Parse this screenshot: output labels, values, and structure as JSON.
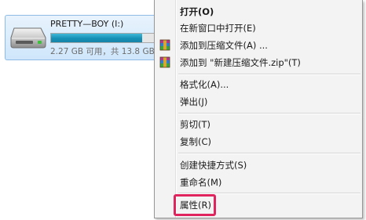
{
  "drive": {
    "name": "PRETTY—BOY (I:)",
    "space_text": "2.27 GB 可用，共 13.8 GB",
    "used_fraction": 0.84,
    "icon": "usb-drive-icon"
  },
  "context_menu": {
    "items": [
      {
        "label": "打开(O)",
        "bold": true,
        "icon": null
      },
      {
        "label": "在新窗口中打开(E)",
        "bold": false,
        "icon": null
      },
      {
        "label": "添加到压缩文件(A) ...",
        "bold": false,
        "icon": "winrar-archive-icon"
      },
      {
        "label": "添加到 \"新建压缩文件.zip\"(T)",
        "bold": false,
        "icon": "winrar-archive-icon"
      },
      {
        "label": "格式化(A)...",
        "bold": false,
        "icon": null
      },
      {
        "label": "弹出(J)",
        "bold": false,
        "icon": null
      },
      {
        "label": "剪切(T)",
        "bold": false,
        "icon": null
      },
      {
        "label": "复制(C)",
        "bold": false,
        "icon": null
      },
      {
        "label": "创建快捷方式(S)",
        "bold": false,
        "icon": null
      },
      {
        "label": "重命名(M)",
        "bold": false,
        "icon": null
      },
      {
        "label": "属性(R)",
        "bold": false,
        "icon": null,
        "highlighted": true
      }
    ]
  },
  "colors": {
    "highlight_border": "#e0245e",
    "drive_bar": "#1690b6",
    "tile_bg": "#dbeefd"
  }
}
